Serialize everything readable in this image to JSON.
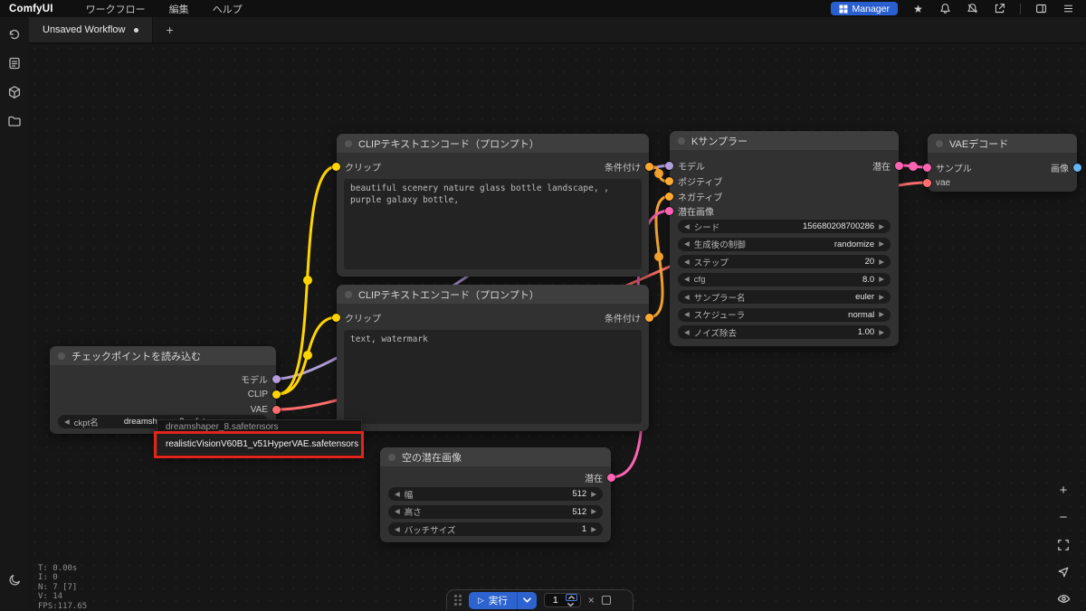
{
  "app": {
    "logo": "ComfyUI"
  },
  "topbar": {
    "menus": [
      "ワークフロー",
      "編集",
      "ヘルプ"
    ],
    "manager": "Manager"
  },
  "tabs": {
    "active": "Unsaved Workflow",
    "new": "+"
  },
  "colors": {
    "model": "#B39DDB",
    "clip": "#FFD500",
    "vae": "#FF6E6E",
    "conditioning": "#FFA931",
    "latent": "#FF64B4",
    "image": "#64B5F6",
    "accent": "#2C63CF",
    "annotation": "#E1251B"
  },
  "nodes": {
    "checkpoint": {
      "title": "チェックポイントを読み込む",
      "outputs": [
        "モデル",
        "CLIP",
        "VAE"
      ],
      "widget": {
        "label": "ckpt名",
        "value": "dreamshaper_8.safetensors"
      }
    },
    "clip_pos": {
      "title": "CLIPテキストエンコード（プロンプト）",
      "input": "クリップ",
      "output": "条件付け",
      "text": "beautiful scenery nature glass bottle landscape, , purple galaxy bottle,"
    },
    "clip_neg": {
      "title": "CLIPテキストエンコード（プロンプト）",
      "input": "クリップ",
      "output": "条件付け",
      "text": "text, watermark"
    },
    "ksampler": {
      "title": "Kサンプラー",
      "inputs": [
        "モデル",
        "ポジティブ",
        "ネガティブ",
        "潜在画像"
      ],
      "output": "潜在",
      "widgets": [
        {
          "label": "シード",
          "value": "156680208700286"
        },
        {
          "label": "生成後の制御",
          "value": "randomize"
        },
        {
          "label": "ステップ",
          "value": "20"
        },
        {
          "label": "cfg",
          "value": "8.0"
        },
        {
          "label": "サンプラー名",
          "value": "euler"
        },
        {
          "label": "スケジューラ",
          "value": "normal"
        },
        {
          "label": "ノイズ除去",
          "value": "1.00"
        }
      ]
    },
    "vae_decode": {
      "title": "VAEデコード",
      "inputs": [
        "サンプル",
        "vae"
      ],
      "output": "画像"
    },
    "empty_latent": {
      "title": "空の潜在画像",
      "output": "潜在",
      "widgets": [
        {
          "label": "幅",
          "value": "512"
        },
        {
          "label": "高さ",
          "value": "512"
        },
        {
          "label": "バッチサイズ",
          "value": "1"
        }
      ]
    }
  },
  "dropdown": {
    "items": [
      "dreamshaper_8.safetensors",
      "realisticVisionV60B1_v51HyperVAE.safetensors"
    ]
  },
  "status": {
    "lines": [
      "T: 0.00s",
      "I: 0",
      "N: 7 [7]",
      "V: 14",
      "FPS:117.65"
    ]
  },
  "runbar": {
    "run": "実行",
    "count": "1"
  }
}
